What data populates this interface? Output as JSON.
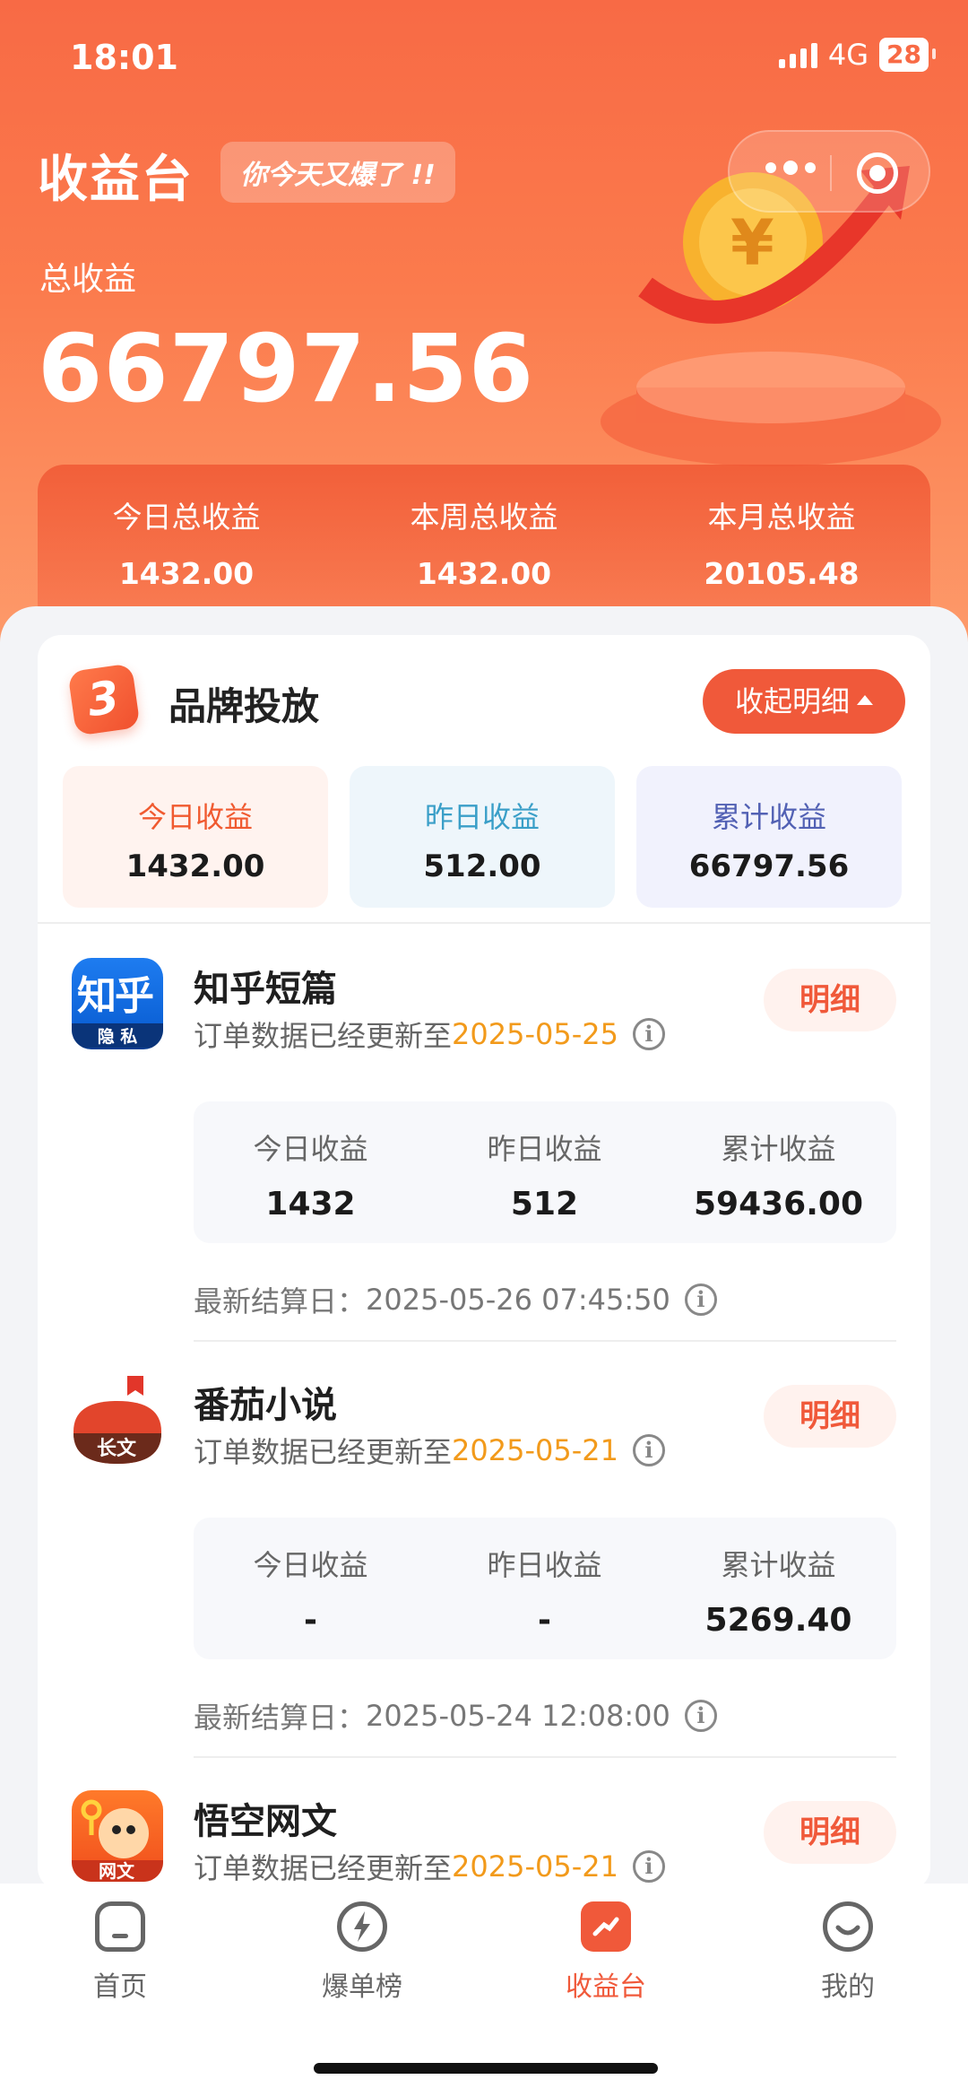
{
  "status_bar": {
    "time": "18:01",
    "network": "4G",
    "battery": "28"
  },
  "header": {
    "title": "收益台",
    "tag": "你今天又爆了 !!",
    "total_label": "总收益",
    "total_value": "66797.56"
  },
  "period_summary": [
    {
      "label": "今日总收益",
      "value": "1432.00"
    },
    {
      "label": "本周总收益",
      "value": "1432.00"
    },
    {
      "label": "本月总收益",
      "value": "20105.48"
    }
  ],
  "brand": {
    "name": "品牌投放",
    "collapse_label": "收起明细",
    "tiles": [
      {
        "label": "今日收益",
        "value": "1432.00"
      },
      {
        "label": "昨日收益",
        "value": "512.00"
      },
      {
        "label": "累计收益",
        "value": "66797.56"
      }
    ]
  },
  "products": [
    {
      "name": "知乎短篇",
      "logo_text": "知乎",
      "logo_sub": "隐 私",
      "update_prefix": "订单数据已经更新至",
      "update_date": "2025-05-25",
      "detail_label": "明细",
      "stats": [
        {
          "label": "今日收益",
          "value": "1432"
        },
        {
          "label": "昨日收益",
          "value": "512"
        },
        {
          "label": "累计收益",
          "value": "59436.00"
        }
      ],
      "settle_label": "最新结算日：",
      "settle_time": "2025-05-26 07:45:50"
    },
    {
      "name": "番茄小说",
      "logo_text": "长文",
      "update_prefix": "订单数据已经更新至",
      "update_date": "2025-05-21",
      "detail_label": "明细",
      "stats": [
        {
          "label": "今日收益",
          "value": "-"
        },
        {
          "label": "昨日收益",
          "value": "-"
        },
        {
          "label": "累计收益",
          "value": "5269.40"
        }
      ],
      "settle_label": "最新结算日：",
      "settle_time": "2025-05-24 12:08:00"
    },
    {
      "name": "悟空网文",
      "logo_text": "网文",
      "update_prefix": "订单数据已经更新至",
      "update_date": "2025-05-21",
      "detail_label": "明细"
    }
  ],
  "tabbar": [
    {
      "label": "首页",
      "icon": "home-icon"
    },
    {
      "label": "爆单榜",
      "icon": "lightning-icon"
    },
    {
      "label": "收益台",
      "icon": "earnings-icon",
      "active": true
    },
    {
      "label": "我的",
      "icon": "profile-icon"
    }
  ],
  "colors": {
    "accent": "#f0593a",
    "date_highlight": "#f29a1b",
    "hero": "#f86a45"
  }
}
